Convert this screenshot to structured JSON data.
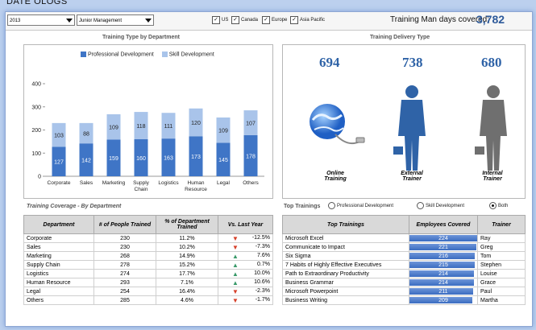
{
  "top_text": "DATE OLOGS",
  "toolbar": {
    "year": "2013",
    "level": "Junior Management",
    "regions": [
      {
        "label": "US",
        "checked": true
      },
      {
        "label": "Canada",
        "checked": true
      },
      {
        "label": "Europe",
        "checked": true
      },
      {
        "label": "Asia Pacific",
        "checked": true
      }
    ],
    "mandays_label": "Training Man days covered:",
    "mandays_value": "3,782"
  },
  "chart_title": "Training Type by Department",
  "chart_data": {
    "type": "bar",
    "categories": [
      "Corporate",
      "Sales",
      "Marketing",
      "Supply Chain",
      "Logistics",
      "Human Resource",
      "Legal",
      "Others"
    ],
    "series": [
      {
        "name": "Professional Development",
        "values": [
          127,
          142,
          159,
          160,
          163,
          173,
          145,
          178
        ]
      },
      {
        "name": "Skill Development",
        "values": [
          103,
          88,
          109,
          118,
          111,
          120,
          109,
          107
        ]
      }
    ],
    "yticks": [
      0,
      100,
      200,
      300,
      400
    ],
    "ylim": [
      0,
      400
    ],
    "colors": {
      "Professional Development": "#3f75c6",
      "Skill Development": "#a9c4ea"
    },
    "stacked": true,
    "legend": "top",
    "grid": false
  },
  "delivery": {
    "title": "Training Delivery Type",
    "items": [
      {
        "value": "694",
        "label1": "Online",
        "label2": "Training"
      },
      {
        "value": "738",
        "label1": "External",
        "label2": "Trainer"
      },
      {
        "value": "680",
        "label1": "Internal",
        "label2": "Trainer"
      }
    ]
  },
  "coverage": {
    "title": "Training Coverage - By Department",
    "headers": [
      "Department",
      "# of People Trained",
      "% of Department Trained",
      "Vs. Last Year"
    ],
    "rows": [
      {
        "dept": "Corporate",
        "people": "230",
        "pct": "11.2%",
        "trend": "down",
        "vs": "-12.5%"
      },
      {
        "dept": "Sales",
        "people": "230",
        "pct": "10.2%",
        "trend": "down",
        "vs": "-7.3%"
      },
      {
        "dept": "Marketing",
        "people": "268",
        "pct": "14.9%",
        "trend": "up",
        "vs": "7.6%"
      },
      {
        "dept": "Supply Chain",
        "people": "278",
        "pct": "15.2%",
        "trend": "up",
        "vs": "0.7%"
      },
      {
        "dept": "Logistics",
        "people": "274",
        "pct": "17.7%",
        "trend": "up",
        "vs": "10.0%"
      },
      {
        "dept": "Human Resource",
        "people": "293",
        "pct": "7.1%",
        "trend": "up",
        "vs": "10.6%"
      },
      {
        "dept": "Legal",
        "people": "254",
        "pct": "16.4%",
        "trend": "down",
        "vs": "-2.3%"
      },
      {
        "dept": "Others",
        "people": "285",
        "pct": "4.6%",
        "trend": "down",
        "vs": "-1.7%"
      }
    ]
  },
  "top_trainings": {
    "title": "Top Trainings",
    "options": [
      {
        "label": "Professional Development",
        "selected": false
      },
      {
        "label": "Skill Development",
        "selected": false
      },
      {
        "label": "Both",
        "selected": true
      }
    ],
    "headers": [
      "Top Trainings",
      "Employees Covered",
      "Trainer"
    ],
    "max_value": 224,
    "rows": [
      {
        "name": "Microsoft Excel",
        "covered": 224,
        "trainer": "Ray"
      },
      {
        "name": "Communicate to Impact",
        "covered": 221,
        "trainer": "Greg"
      },
      {
        "name": "Six Sigma",
        "covered": 216,
        "trainer": "Tom"
      },
      {
        "name": "7 Habits of Highly Effective Executives",
        "covered": 215,
        "trainer": "Stephen"
      },
      {
        "name": "Path to Extraordinary Productivity",
        "covered": 214,
        "trainer": "Louise"
      },
      {
        "name": "Business Grammar",
        "covered": 214,
        "trainer": "Grace"
      },
      {
        "name": "Microsoft Powerpoint",
        "covered": 211,
        "trainer": "Paul"
      },
      {
        "name": "Business Writing",
        "covered": 209,
        "trainer": "Martha"
      }
    ]
  }
}
